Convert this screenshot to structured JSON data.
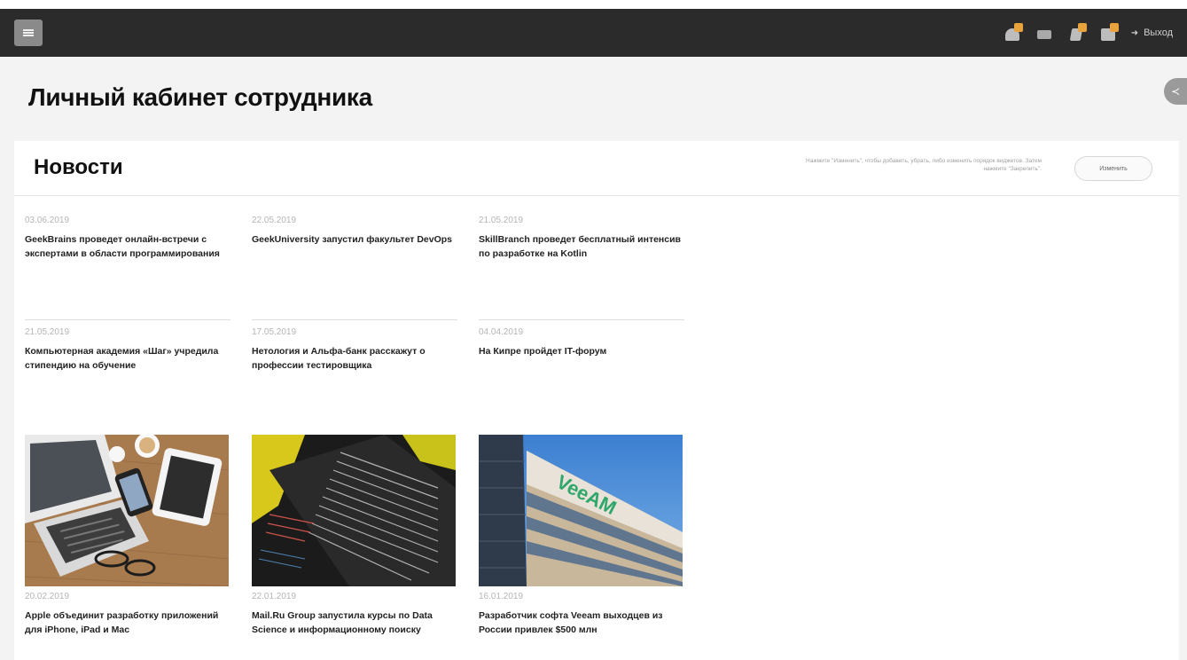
{
  "header": {
    "logout_label": "Выход"
  },
  "page": {
    "title": "Личный кабинет сотрудника"
  },
  "news_panel": {
    "title": "Новости",
    "hint": "Нажмите \"Изменить\", чтобы добавить, убрать, либо изменить порядок виджетов. Затем нажмите \"Закрепить\".",
    "edit_button": "Изменить",
    "items": [
      {
        "date": "03.06.2019",
        "title": "GeekBrains проведет онлайн-встречи с экспертами в области программирования"
      },
      {
        "date": "22.05.2019",
        "title": "GeekUniversity запустил факультет DevOps"
      },
      {
        "date": "21.05.2019",
        "title": "SkillBranch проведет бесплатный интенсив по разработке на Kotlin"
      },
      {
        "date": "21.05.2019",
        "title": "Компьютерная академия «Шаг» учредила стипендию на обучение"
      },
      {
        "date": "17.05.2019",
        "title": "Нетология и Альфа-банк расскажут о профессии тестировщика"
      },
      {
        "date": "04.04.2019",
        "title": "На Кипре пройдет IT-форум"
      },
      {
        "date": "20.02.2019",
        "title": "Apple объединит разработку приложений для iPhone, iPad и Mac"
      },
      {
        "date": "22.01.2019",
        "title": "Mail.Ru Group запустила курсы по Data Science и информационному поиску"
      },
      {
        "date": "16.01.2019",
        "title": "Разработчик софта Veeam выходцев из России привлек $500 млн"
      }
    ],
    "image_text": {
      "veeam_logo": "VeeAM"
    }
  }
}
